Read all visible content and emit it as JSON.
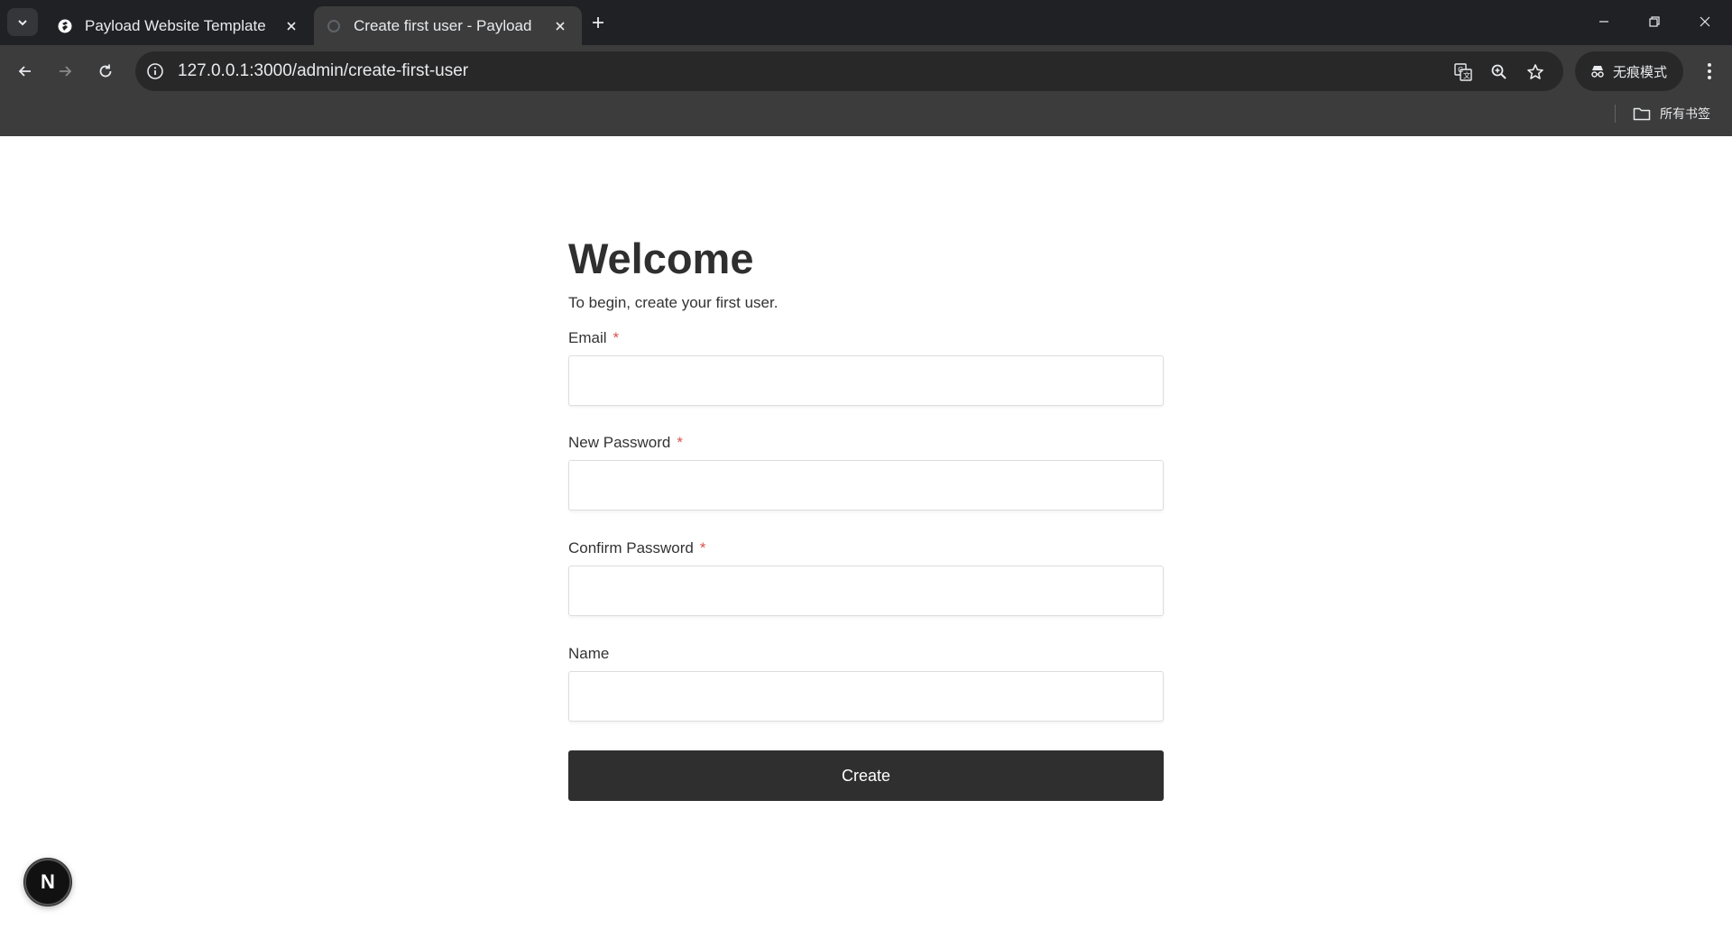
{
  "browser": {
    "tabs": [
      {
        "title": "Payload Website Template",
        "active": false
      },
      {
        "title": "Create first user - Payload",
        "active": true
      }
    ],
    "url": "127.0.0.1:3000/admin/create-first-user",
    "incognito_label": "无痕模式",
    "bookmarks_all_label": "所有书签"
  },
  "page": {
    "heading": "Welcome",
    "intro": "To begin, create your first user.",
    "fields": [
      {
        "label": "Email",
        "required": "*",
        "value": ""
      },
      {
        "label": "New Password",
        "required": "*",
        "value": ""
      },
      {
        "label": "Confirm Password",
        "required": "*",
        "value": ""
      },
      {
        "label": "Name",
        "required": "",
        "value": ""
      }
    ],
    "submit_label": "Create",
    "next_badge_letter": "N"
  },
  "colors": {
    "chrome_dark": "#202124",
    "chrome_toolbar": "#3c3c3c",
    "button_dark": "#2f2f2f",
    "required_red": "#d9534f"
  }
}
